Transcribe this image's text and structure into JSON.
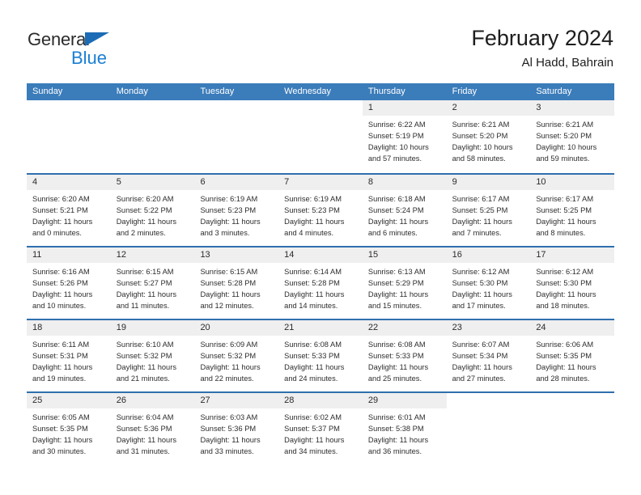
{
  "brand": {
    "name_part1": "General",
    "name_part2": "Blue",
    "triangle_icon": "blue-triangle-icon"
  },
  "header": {
    "title": "February 2024",
    "subtitle": "Al Hadd, Bahrain"
  },
  "colors": {
    "header_blue": "#3b7cba",
    "row_divider_blue": "#2f6fad",
    "daynum_band": "#efeff0",
    "brand_blue": "#1b7fd4",
    "text": "#2d2d2d"
  },
  "weekdays": [
    "Sunday",
    "Monday",
    "Tuesday",
    "Wednesday",
    "Thursday",
    "Friday",
    "Saturday"
  ],
  "weeks": [
    [
      {
        "empty": true
      },
      {
        "empty": true
      },
      {
        "empty": true
      },
      {
        "empty": true
      },
      {
        "day": "1",
        "sunrise": "Sunrise: 6:22 AM",
        "sunset": "Sunset: 5:19 PM",
        "daylight1": "Daylight: 10 hours",
        "daylight2": "and 57 minutes."
      },
      {
        "day": "2",
        "sunrise": "Sunrise: 6:21 AM",
        "sunset": "Sunset: 5:20 PM",
        "daylight1": "Daylight: 10 hours",
        "daylight2": "and 58 minutes."
      },
      {
        "day": "3",
        "sunrise": "Sunrise: 6:21 AM",
        "sunset": "Sunset: 5:20 PM",
        "daylight1": "Daylight: 10 hours",
        "daylight2": "and 59 minutes."
      }
    ],
    [
      {
        "day": "4",
        "sunrise": "Sunrise: 6:20 AM",
        "sunset": "Sunset: 5:21 PM",
        "daylight1": "Daylight: 11 hours",
        "daylight2": "and 0 minutes."
      },
      {
        "day": "5",
        "sunrise": "Sunrise: 6:20 AM",
        "sunset": "Sunset: 5:22 PM",
        "daylight1": "Daylight: 11 hours",
        "daylight2": "and 2 minutes."
      },
      {
        "day": "6",
        "sunrise": "Sunrise: 6:19 AM",
        "sunset": "Sunset: 5:23 PM",
        "daylight1": "Daylight: 11 hours",
        "daylight2": "and 3 minutes."
      },
      {
        "day": "7",
        "sunrise": "Sunrise: 6:19 AM",
        "sunset": "Sunset: 5:23 PM",
        "daylight1": "Daylight: 11 hours",
        "daylight2": "and 4 minutes."
      },
      {
        "day": "8",
        "sunrise": "Sunrise: 6:18 AM",
        "sunset": "Sunset: 5:24 PM",
        "daylight1": "Daylight: 11 hours",
        "daylight2": "and 6 minutes."
      },
      {
        "day": "9",
        "sunrise": "Sunrise: 6:17 AM",
        "sunset": "Sunset: 5:25 PM",
        "daylight1": "Daylight: 11 hours",
        "daylight2": "and 7 minutes."
      },
      {
        "day": "10",
        "sunrise": "Sunrise: 6:17 AM",
        "sunset": "Sunset: 5:25 PM",
        "daylight1": "Daylight: 11 hours",
        "daylight2": "and 8 minutes."
      }
    ],
    [
      {
        "day": "11",
        "sunrise": "Sunrise: 6:16 AM",
        "sunset": "Sunset: 5:26 PM",
        "daylight1": "Daylight: 11 hours",
        "daylight2": "and 10 minutes."
      },
      {
        "day": "12",
        "sunrise": "Sunrise: 6:15 AM",
        "sunset": "Sunset: 5:27 PM",
        "daylight1": "Daylight: 11 hours",
        "daylight2": "and 11 minutes."
      },
      {
        "day": "13",
        "sunrise": "Sunrise: 6:15 AM",
        "sunset": "Sunset: 5:28 PM",
        "daylight1": "Daylight: 11 hours",
        "daylight2": "and 12 minutes."
      },
      {
        "day": "14",
        "sunrise": "Sunrise: 6:14 AM",
        "sunset": "Sunset: 5:28 PM",
        "daylight1": "Daylight: 11 hours",
        "daylight2": "and 14 minutes."
      },
      {
        "day": "15",
        "sunrise": "Sunrise: 6:13 AM",
        "sunset": "Sunset: 5:29 PM",
        "daylight1": "Daylight: 11 hours",
        "daylight2": "and 15 minutes."
      },
      {
        "day": "16",
        "sunrise": "Sunrise: 6:12 AM",
        "sunset": "Sunset: 5:30 PM",
        "daylight1": "Daylight: 11 hours",
        "daylight2": "and 17 minutes."
      },
      {
        "day": "17",
        "sunrise": "Sunrise: 6:12 AM",
        "sunset": "Sunset: 5:30 PM",
        "daylight1": "Daylight: 11 hours",
        "daylight2": "and 18 minutes."
      }
    ],
    [
      {
        "day": "18",
        "sunrise": "Sunrise: 6:11 AM",
        "sunset": "Sunset: 5:31 PM",
        "daylight1": "Daylight: 11 hours",
        "daylight2": "and 19 minutes."
      },
      {
        "day": "19",
        "sunrise": "Sunrise: 6:10 AM",
        "sunset": "Sunset: 5:32 PM",
        "daylight1": "Daylight: 11 hours",
        "daylight2": "and 21 minutes."
      },
      {
        "day": "20",
        "sunrise": "Sunrise: 6:09 AM",
        "sunset": "Sunset: 5:32 PM",
        "daylight1": "Daylight: 11 hours",
        "daylight2": "and 22 minutes."
      },
      {
        "day": "21",
        "sunrise": "Sunrise: 6:08 AM",
        "sunset": "Sunset: 5:33 PM",
        "daylight1": "Daylight: 11 hours",
        "daylight2": "and 24 minutes."
      },
      {
        "day": "22",
        "sunrise": "Sunrise: 6:08 AM",
        "sunset": "Sunset: 5:33 PM",
        "daylight1": "Daylight: 11 hours",
        "daylight2": "and 25 minutes."
      },
      {
        "day": "23",
        "sunrise": "Sunrise: 6:07 AM",
        "sunset": "Sunset: 5:34 PM",
        "daylight1": "Daylight: 11 hours",
        "daylight2": "and 27 minutes."
      },
      {
        "day": "24",
        "sunrise": "Sunrise: 6:06 AM",
        "sunset": "Sunset: 5:35 PM",
        "daylight1": "Daylight: 11 hours",
        "daylight2": "and 28 minutes."
      }
    ],
    [
      {
        "day": "25",
        "sunrise": "Sunrise: 6:05 AM",
        "sunset": "Sunset: 5:35 PM",
        "daylight1": "Daylight: 11 hours",
        "daylight2": "and 30 minutes."
      },
      {
        "day": "26",
        "sunrise": "Sunrise: 6:04 AM",
        "sunset": "Sunset: 5:36 PM",
        "daylight1": "Daylight: 11 hours",
        "daylight2": "and 31 minutes."
      },
      {
        "day": "27",
        "sunrise": "Sunrise: 6:03 AM",
        "sunset": "Sunset: 5:36 PM",
        "daylight1": "Daylight: 11 hours",
        "daylight2": "and 33 minutes."
      },
      {
        "day": "28",
        "sunrise": "Sunrise: 6:02 AM",
        "sunset": "Sunset: 5:37 PM",
        "daylight1": "Daylight: 11 hours",
        "daylight2": "and 34 minutes."
      },
      {
        "day": "29",
        "sunrise": "Sunrise: 6:01 AM",
        "sunset": "Sunset: 5:38 PM",
        "daylight1": "Daylight: 11 hours",
        "daylight2": "and 36 minutes."
      },
      {
        "empty": true
      },
      {
        "empty": true
      }
    ]
  ]
}
